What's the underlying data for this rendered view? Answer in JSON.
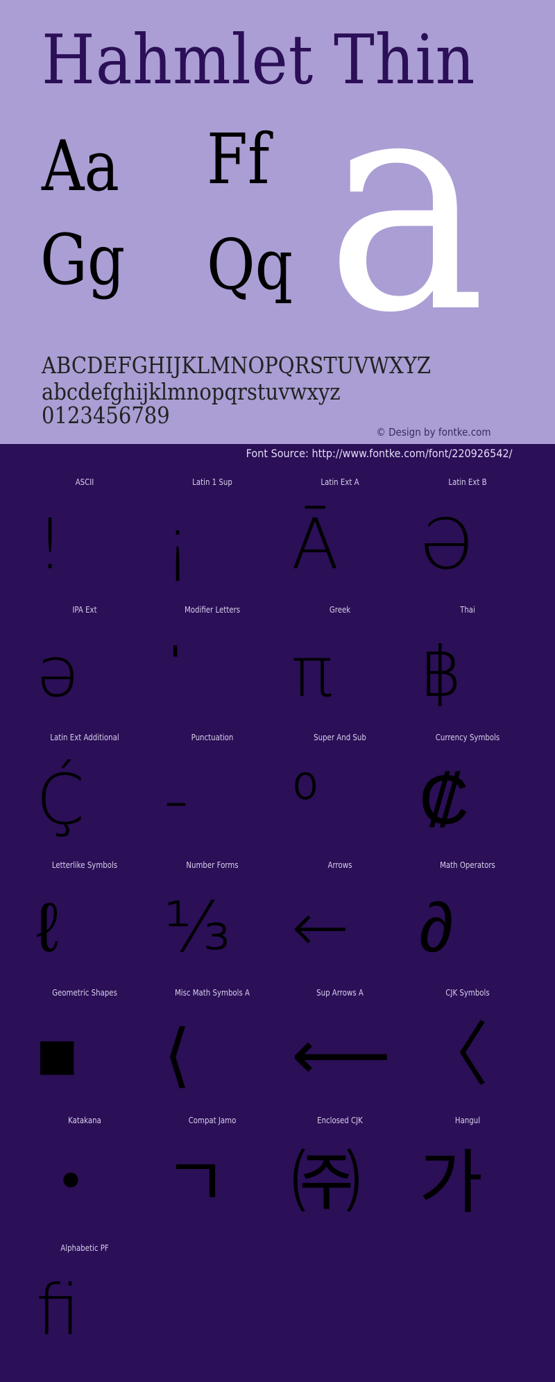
{
  "header": {
    "title": "Hahmlet Thin",
    "pairs": [
      "Aa",
      "Ff",
      "Gg",
      "Qq"
    ],
    "hero_glyph": "a",
    "uppercase": "ABCDEFGHIJKLMNOPQRSTUVWXYZ",
    "lowercase": "abcdefghijklmnopqrstuvwxyz",
    "digits": "0123456789",
    "credit": "© Design by fontke.com",
    "source": "Font Source: http://www.fontke.com/font/220926542/"
  },
  "colors": {
    "top_background": "#ab9ed4",
    "bottom_background": "#2b0f57",
    "title_color": "#2b0f57",
    "hero_color": "#ffffff",
    "glyph_color": "#000000",
    "label_color": "#d8d0ea"
  },
  "blocks": [
    {
      "label": "ASCII",
      "glyph": "!"
    },
    {
      "label": "Latin 1 Sup",
      "glyph": "¡"
    },
    {
      "label": "Latin Ext A",
      "glyph": "Ā"
    },
    {
      "label": "Latin Ext B",
      "glyph": "Ə"
    },
    {
      "label": "IPA Ext",
      "glyph": "ə"
    },
    {
      "label": "Modifier Letters",
      "glyph": "ˈ"
    },
    {
      "label": "Greek",
      "glyph": "π"
    },
    {
      "label": "Thai",
      "glyph": "฿"
    },
    {
      "label": "Latin Ext Additional",
      "glyph": "Ḉ"
    },
    {
      "label": "Punctuation",
      "glyph": "‐"
    },
    {
      "label": "Super And Sub",
      "glyph": "⁰"
    },
    {
      "label": "Currency Symbols",
      "glyph": "₡"
    },
    {
      "label": "Letterlike Symbols",
      "glyph": "ℓ"
    },
    {
      "label": "Number Forms",
      "glyph": "⅓"
    },
    {
      "label": "Arrows",
      "glyph": "←"
    },
    {
      "label": "Math Operators",
      "glyph": "∂"
    },
    {
      "label": "Geometric Shapes",
      "glyph": "■"
    },
    {
      "label": "Misc Math Symbols A",
      "glyph": "⟨"
    },
    {
      "label": "Sup Arrows A",
      "glyph": "⟵"
    },
    {
      "label": "CJK Symbols",
      "glyph": "〈"
    },
    {
      "label": "Katakana",
      "glyph": "・"
    },
    {
      "label": "Compat Jamo",
      "glyph": "ㄱ"
    },
    {
      "label": "Enclosed CJK",
      "glyph": "㈜"
    },
    {
      "label": "Hangul",
      "glyph": "가"
    },
    {
      "label": "Alphabetic PF",
      "glyph": "ﬁ"
    }
  ]
}
